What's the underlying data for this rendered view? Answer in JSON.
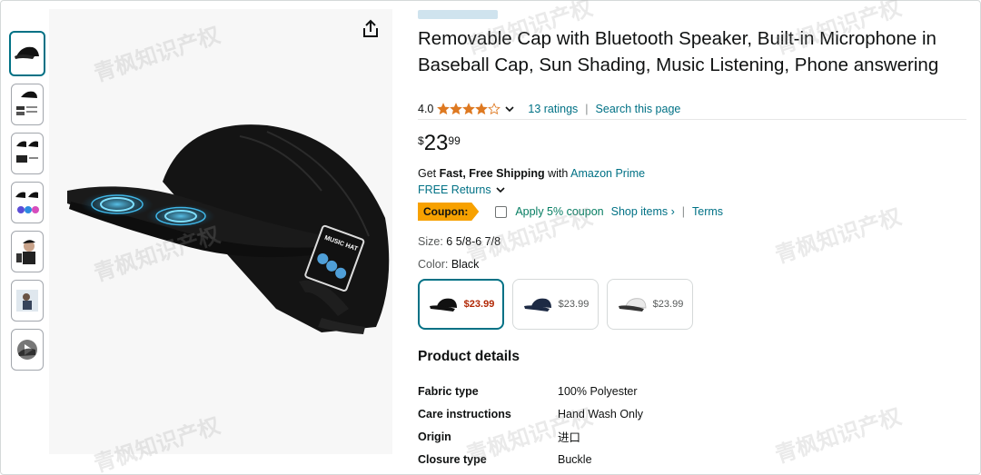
{
  "product": {
    "title": "Removable Cap with Bluetooth Speaker, Built-in Microphone in Baseball Cap, Sun Shading, Music Listening, Phone answering",
    "rating_value": "4.0",
    "ratings_link": "13 ratings",
    "search_link": "Search this page",
    "price": {
      "symbol": "$",
      "whole": "23",
      "fraction": "99"
    },
    "shipping_prefix": "Get ",
    "shipping_bold": "Fast, Free Shipping",
    "shipping_with": " with ",
    "shipping_prime": "Amazon Prime",
    "returns_label": "FREE Returns",
    "coupon_tag": "Coupon:",
    "coupon_text": "Apply 5% coupon",
    "shop_items": "Shop items ›",
    "terms": "Terms",
    "size_label": "Size:",
    "size_value": "6 5/8-6 7/8",
    "color_label": "Color:",
    "color_value": "Black",
    "stars": 4,
    "stars_total": 5,
    "swatches": [
      {
        "color": "#111111",
        "price": "$23.99"
      },
      {
        "color": "#1d2a44",
        "price": "$23.99"
      },
      {
        "color": "#e9e9e9",
        "price": "$23.99"
      }
    ]
  },
  "details": {
    "heading": "Product details",
    "rows": [
      {
        "key": "Fabric type",
        "value": "100% Polyester"
      },
      {
        "key": "Care instructions",
        "value": "Hand Wash Only"
      },
      {
        "key": "Origin",
        "value": "进口"
      },
      {
        "key": "Closure type",
        "value": "Buckle"
      }
    ]
  },
  "watermark": {
    "text": "青枫知识产权"
  },
  "colors": {
    "link": "#007185",
    "coupon_green": "#067d62",
    "coupon_tag": "#f7a100",
    "price_red": "#b12704",
    "star": "#de7921"
  }
}
